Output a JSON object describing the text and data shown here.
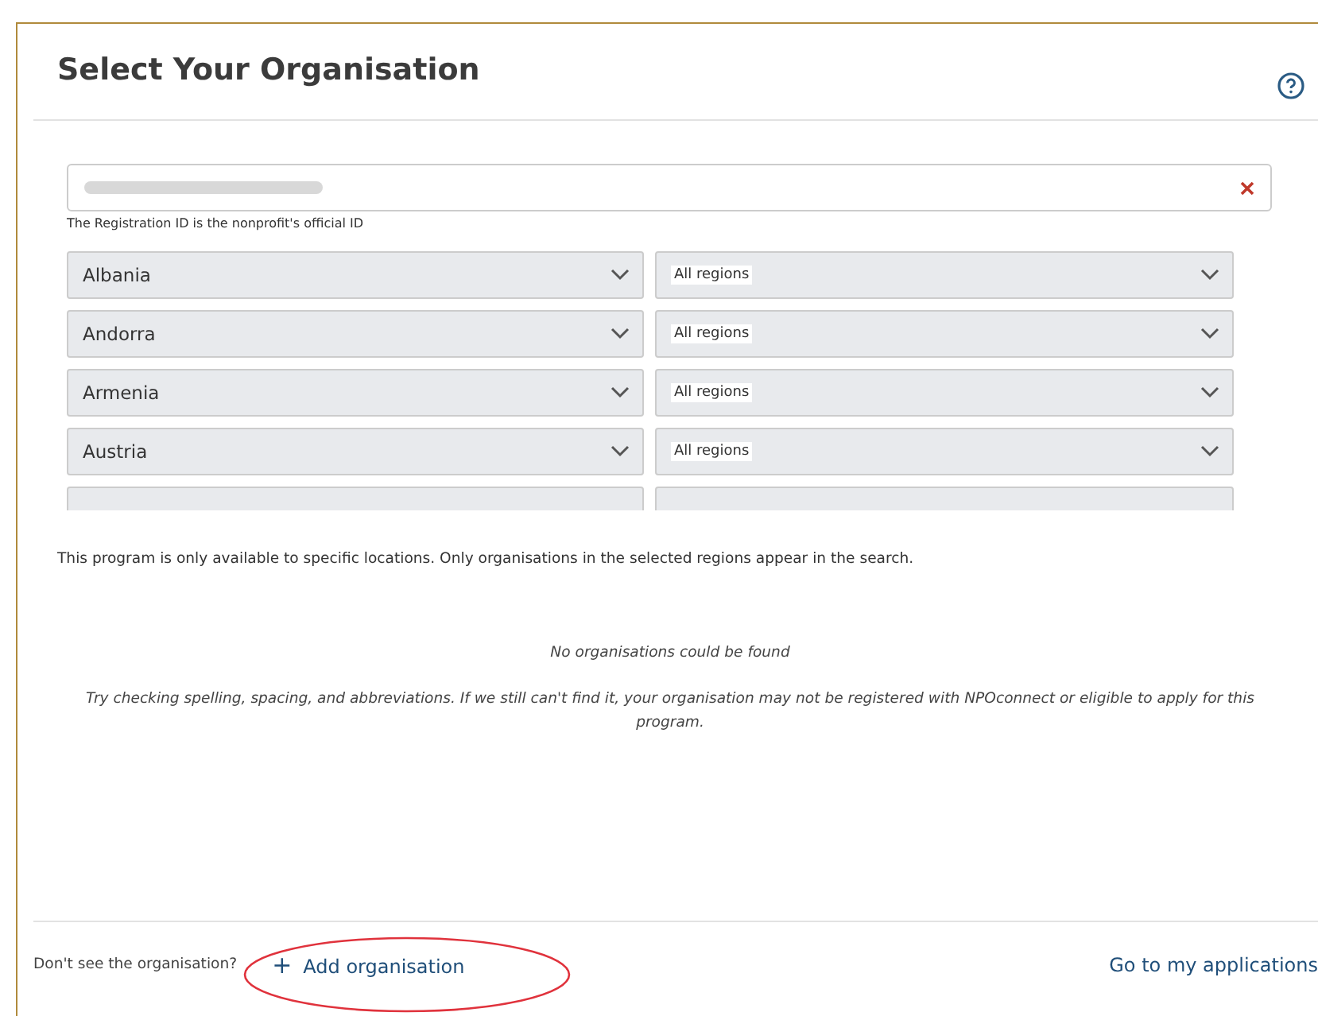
{
  "title": "Select Your Organisation",
  "search": {
    "redacted": true,
    "hint": "The Registration ID is the nonprofit's official ID"
  },
  "locations": [
    {
      "country": "Albania",
      "region": "All regions"
    },
    {
      "country": "Andorra",
      "region": "All regions"
    },
    {
      "country": "Armenia",
      "region": "All regions"
    },
    {
      "country": "Austria",
      "region": "All regions"
    }
  ],
  "more_locations_cut": true,
  "availability_note": "This program is only available to specific locations. Only organisations in the selected regions appear in the search.",
  "empty_title": "No organisations could be found",
  "empty_help": "Try checking spelling, spacing, and abbreviations. If we still can't find it, your organisation may not be registered with NPOconnect or eligible to apply for this program.",
  "footer": {
    "question": "Don't see the organisation?",
    "add_icon": "+",
    "add_link": "Add organisation",
    "circled": true,
    "applications_link": "Go to my applications"
  }
}
